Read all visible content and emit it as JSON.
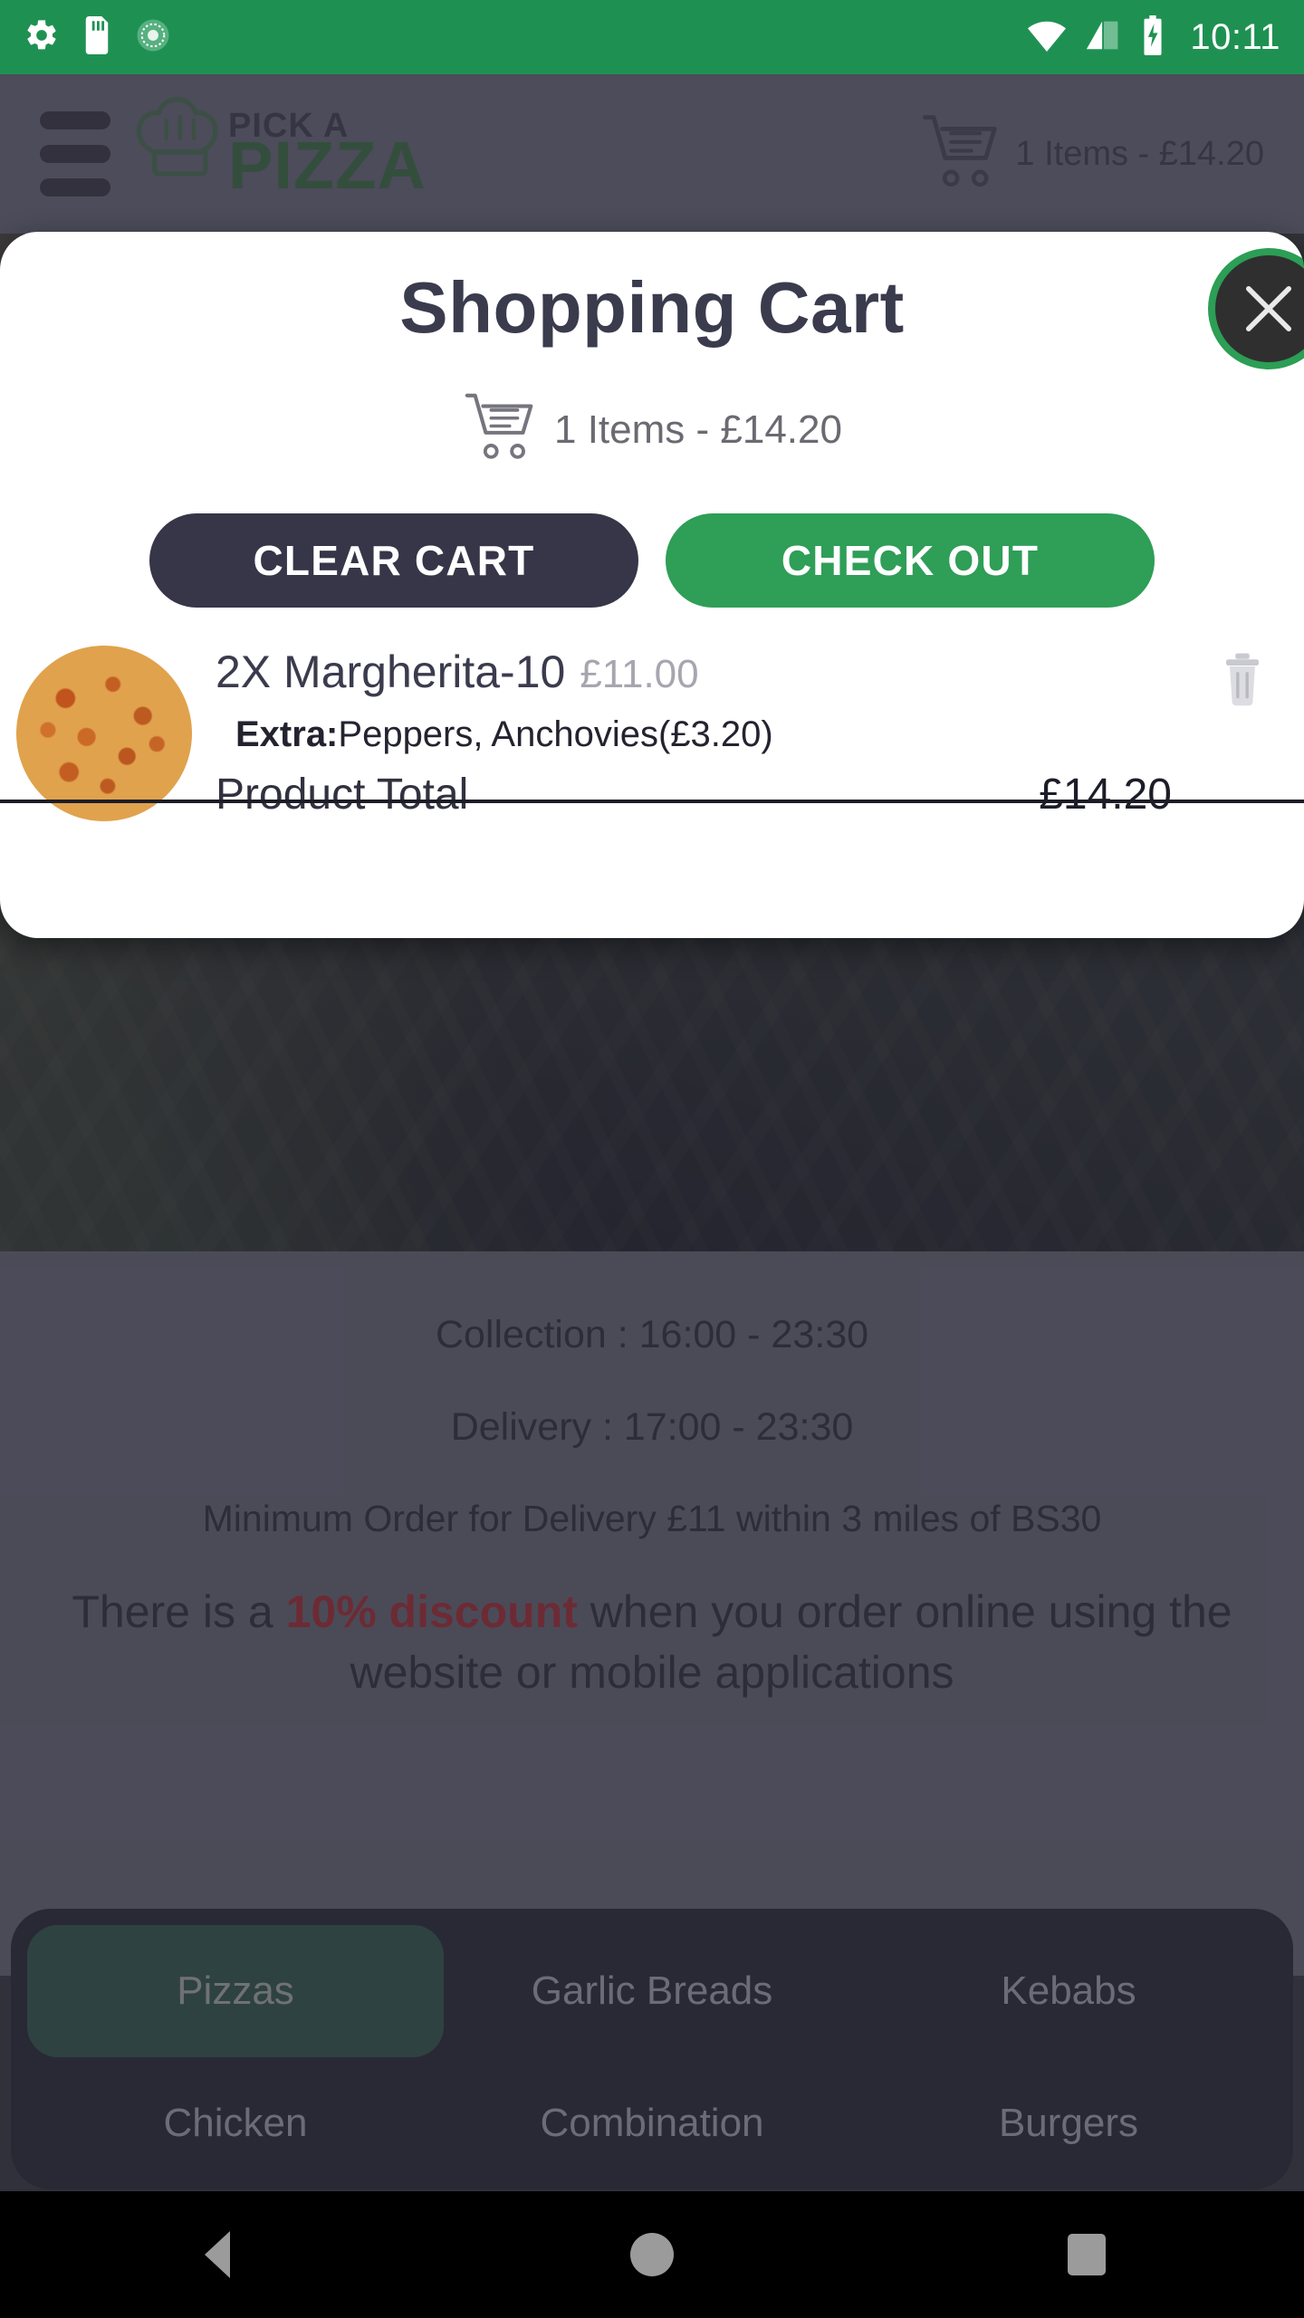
{
  "status_bar": {
    "time": "10:11",
    "left_icons": [
      "settings-gear-icon",
      "sd-card-icon",
      "sync-icon"
    ],
    "right_icons": [
      "wifi-icon",
      "cellular-signal-icon",
      "battery-charging-icon"
    ],
    "background_color": "#1e9152"
  },
  "header": {
    "menu_icon": "hamburger-menu-icon",
    "brand_line1": "PICK A",
    "brand_line2": "PIZZA",
    "brand_icon": "chef-hat-icon",
    "cart_icon": "shopping-cart-icon",
    "cart_summary": "1 Items - £14.20"
  },
  "modal": {
    "title": "Shopping Cart",
    "close_icon": "close-x-icon",
    "close_accent_color": "#2c9e55",
    "cart_icon": "shopping-cart-icon",
    "cart_summary": "1 Items - £14.20",
    "clear_cart_label": "CLEAR CART",
    "check_out_label": "CHECK OUT",
    "clear_cart_color": "#373548",
    "check_out_color": "#2f9e57",
    "items": [
      {
        "thumb": "pizza-photo",
        "name": "2X Margherita-10",
        "base_price": "£11.00",
        "extras_label": "Extra:",
        "extras_value": "Peppers, Anchovies(£3.20)",
        "total_label": "Product Total",
        "total_value": "£14.20",
        "delete_icon": "trash-icon"
      }
    ]
  },
  "info": {
    "collection": "Collection : 16:00 - 23:30",
    "delivery": "Delivery : 17:00 - 23:30",
    "minimum_order": "Minimum Order for Delivery £11 within 3 miles of BS30",
    "discount_prefix": "There is a ",
    "discount_highlight": "10% discount",
    "discount_suffix": " when you order online using the website or mobile applications",
    "discount_color": "#8d2126"
  },
  "categories": {
    "active": "Pizzas",
    "active_color": "#26473c",
    "items": [
      {
        "label": "Pizzas"
      },
      {
        "label": "Garlic Breads"
      },
      {
        "label": "Kebabs"
      },
      {
        "label": "Chicken"
      },
      {
        "label": "Combination"
      },
      {
        "label": "Burgers"
      }
    ]
  },
  "nav_bar": {
    "back": "back-triangle-icon",
    "home": "home-circle-icon",
    "recents": "recents-square-icon"
  }
}
